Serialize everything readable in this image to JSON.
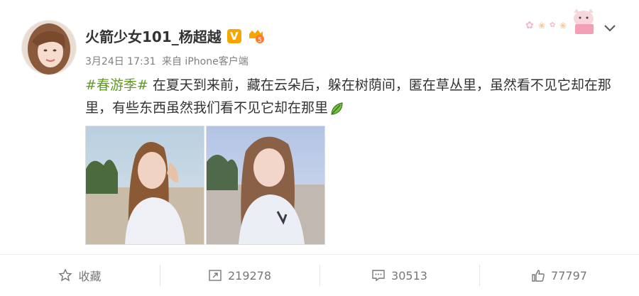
{
  "post": {
    "author": "火箭少女101_杨超越",
    "verified_badge": "V",
    "level_badge": "5",
    "date": "3月24日 17:31",
    "source": "来自 iPhone客户端",
    "hashtag": "#春游季#",
    "text": " 在夏天到来前，藏在云朵后，躲在树荫间，匿在草丛里，虽然看不见它却在那里，有些东西虽然我们看不见它却在那里"
  },
  "actions": {
    "favorite": "收藏",
    "repost_count": "219278",
    "comment_count": "30513",
    "like_count": "77797"
  },
  "icons": {
    "menu": "chevron-down-icon",
    "favorite": "star-icon",
    "repost": "repost-icon",
    "comment": "comment-icon",
    "like": "thumbs-up-icon"
  },
  "colors": {
    "hashtag": "#5f9d1c",
    "verified": "#f7a600",
    "text": "#333333",
    "meta": "#808080"
  }
}
